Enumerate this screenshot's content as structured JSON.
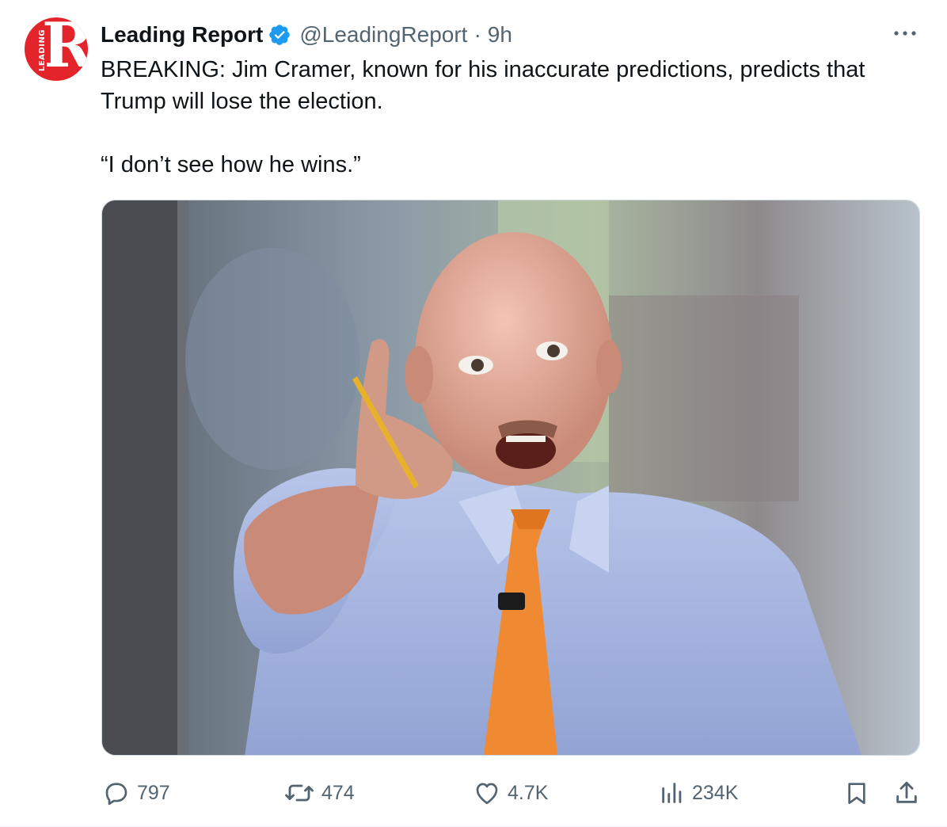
{
  "author": {
    "display_name": "Leading Report",
    "handle": "@LeadingReport",
    "separator": "·",
    "time": "9h",
    "avatar_letter": "R",
    "avatar_text": "LEADING",
    "avatar_color": "#e3242b",
    "verified_color": "#1d9bf0"
  },
  "tweet": {
    "line1": "BREAKING: Jim Cramer, known for his inaccurate predictions, predicts that Trump will lose the election.",
    "line2": "“I don’t see how he wins.”"
  },
  "media": {
    "alt": "photo-of-man-pointing-with-pencil"
  },
  "actions": {
    "replies": "797",
    "reposts": "474",
    "likes": "4.7K",
    "views": "234K"
  },
  "icons": {
    "more": "more-horizontal-icon",
    "reply": "reply-bubble-icon",
    "retweet": "retweet-icon",
    "like": "heart-icon",
    "views": "views-chart-icon",
    "bookmark": "bookmark-icon",
    "share": "share-icon"
  }
}
